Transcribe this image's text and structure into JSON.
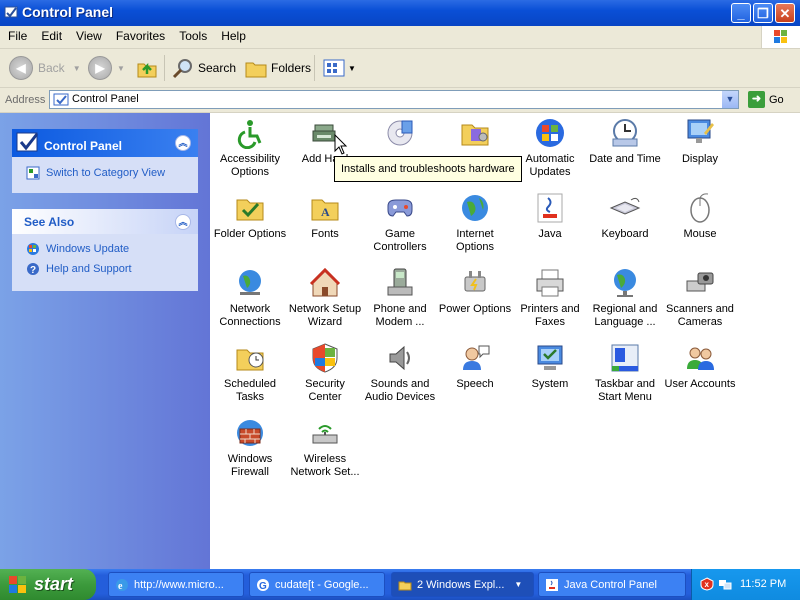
{
  "window": {
    "title": "Control Panel"
  },
  "menubar": {
    "items": [
      "File",
      "Edit",
      "View",
      "Favorites",
      "Tools",
      "Help"
    ]
  },
  "toolbar": {
    "back": "Back",
    "search": "Search",
    "folders": "Folders"
  },
  "address": {
    "label": "Address",
    "value": "Control Panel",
    "go": "Go"
  },
  "sidebar": {
    "control_panel": {
      "title": "Control Panel",
      "switch_view": "Switch to Category View"
    },
    "see_also": {
      "title": "See Also",
      "items": [
        "Windows Update",
        "Help and Support"
      ]
    }
  },
  "items": [
    {
      "line1": "Accessibility",
      "line2": "Options",
      "icon": "accessibility-icon"
    },
    {
      "line1": "Add Hard",
      "line2": "",
      "icon": "add-hardware-icon"
    },
    {
      "line1": "",
      "line2": "",
      "icon": "add-remove-programs-icon"
    },
    {
      "line1": "",
      "line2": "",
      "icon": "administrative-tools-icon"
    },
    {
      "line1": "Automatic",
      "line2": "Updates",
      "icon": "windows-logo-icon"
    },
    {
      "line1": "Date and Time",
      "line2": "",
      "icon": "clock-icon"
    },
    {
      "line1": "Display",
      "line2": "",
      "icon": "display-icon"
    },
    {
      "line1": "Folder Options",
      "line2": "",
      "icon": "folder-options-icon"
    },
    {
      "line1": "Fonts",
      "line2": "",
      "icon": "fonts-folder-icon"
    },
    {
      "line1": "Game",
      "line2": "Controllers",
      "icon": "gamepad-icon"
    },
    {
      "line1": "Internet",
      "line2": "Options",
      "icon": "globe-icon"
    },
    {
      "line1": "Java",
      "line2": "",
      "icon": "java-icon"
    },
    {
      "line1": "Keyboard",
      "line2": "",
      "icon": "keyboard-icon"
    },
    {
      "line1": "Mouse",
      "line2": "",
      "icon": "mouse-icon"
    },
    {
      "line1": "Network",
      "line2": "Connections",
      "icon": "network-globe-icon"
    },
    {
      "line1": "Network Setup",
      "line2": "Wizard",
      "icon": "house-icon"
    },
    {
      "line1": "Phone and",
      "line2": "Modem ...",
      "icon": "phone-icon"
    },
    {
      "line1": "Power Options",
      "line2": "",
      "icon": "power-icon"
    },
    {
      "line1": "Printers and",
      "line2": "Faxes",
      "icon": "printer-icon"
    },
    {
      "line1": "Regional and",
      "line2": "Language ...",
      "icon": "regional-globe-icon"
    },
    {
      "line1": "Scanners and",
      "line2": "Cameras",
      "icon": "scanner-icon"
    },
    {
      "line1": "Scheduled",
      "line2": "Tasks",
      "icon": "scheduled-tasks-icon"
    },
    {
      "line1": "Security",
      "line2": "Center",
      "icon": "shield-icon"
    },
    {
      "line1": "Sounds and",
      "line2": "Audio Devices",
      "icon": "speaker-icon"
    },
    {
      "line1": "Speech",
      "line2": "",
      "icon": "speech-icon"
    },
    {
      "line1": "System",
      "line2": "",
      "icon": "system-icon"
    },
    {
      "line1": "Taskbar and",
      "line2": "Start Menu",
      "icon": "taskbar-icon"
    },
    {
      "line1": "User Accounts",
      "line2": "",
      "icon": "users-icon"
    },
    {
      "line1": "Windows",
      "line2": "Firewall",
      "icon": "firewall-icon"
    },
    {
      "line1": "Wireless",
      "line2": "Network Set...",
      "icon": "wireless-icon"
    }
  ],
  "tooltip": "Installs and troubleshoots hardware",
  "taskbar": {
    "start": "start",
    "tasks": [
      {
        "label": "http://www.micro...",
        "icon": "ie-icon"
      },
      {
        "label": "cudate[t - Google...",
        "icon": "google-icon"
      },
      {
        "label": "2 Windows Expl...",
        "icon": "folder-icon"
      },
      {
        "label": "Java Control Panel",
        "icon": "java-icon"
      }
    ],
    "clock": "11:52 PM"
  }
}
